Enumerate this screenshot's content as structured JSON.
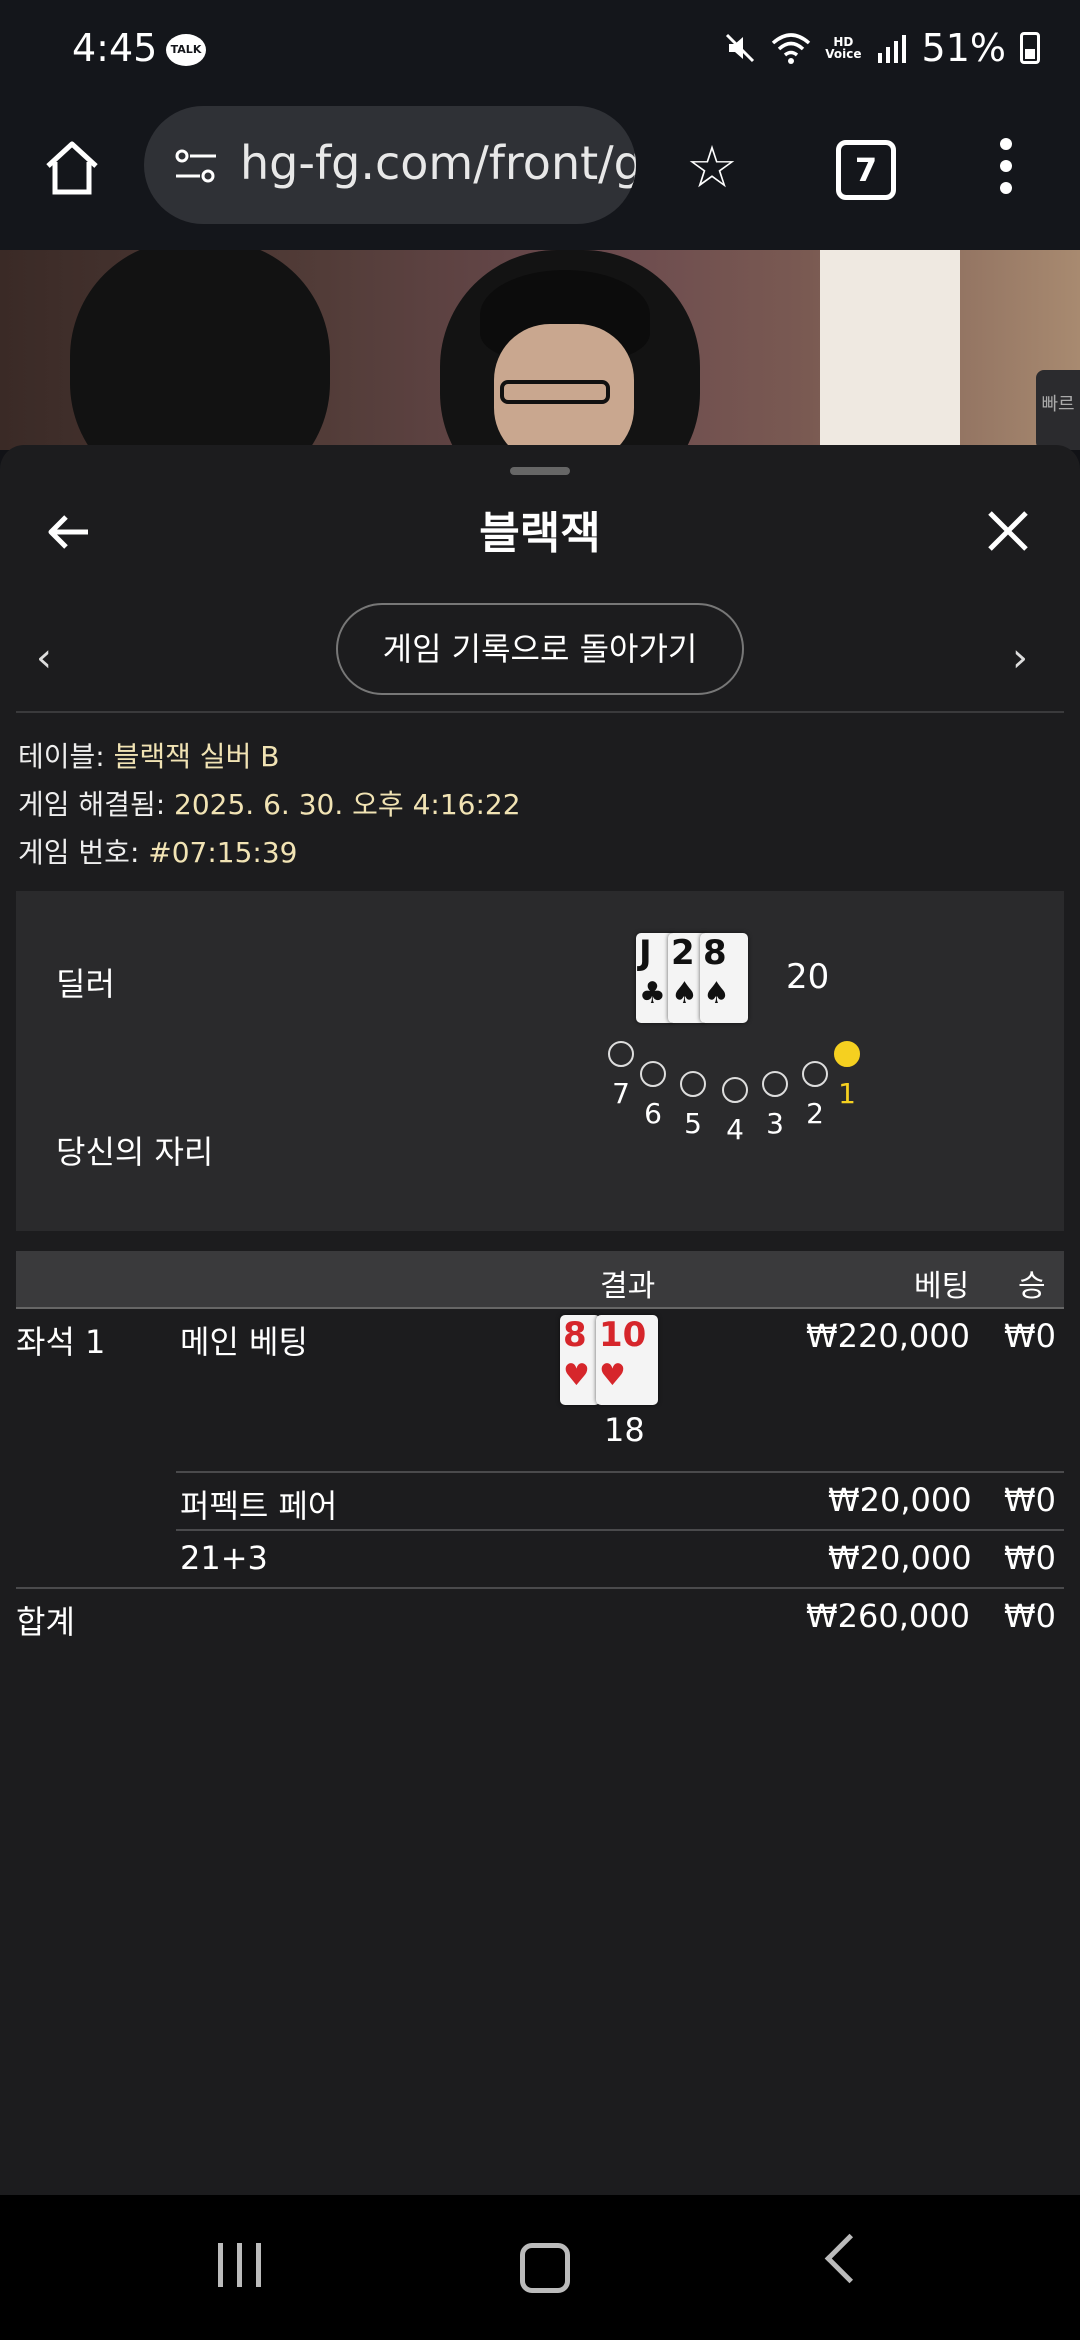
{
  "status_bar": {
    "time": "4:45",
    "talk_badge": "TALK",
    "hd_label": "HD",
    "voice_label": "Voice",
    "battery": "51%"
  },
  "browser": {
    "url": "hg-fg.com/front/g",
    "tab_count": "7"
  },
  "video": {
    "side_tab_label": "빠르"
  },
  "panel": {
    "title": "블랙잭",
    "history_button": "게임 기록으로 돌아가기",
    "info": {
      "table_label": "테이블: ",
      "table_value": "블랙잭 실버 B",
      "resolved_label": "게임 해결됨: ",
      "resolved_value": "2025. 6. 30. 오후 4:16:22",
      "game_no_label": "게임 번호: ",
      "game_no_value": "#07:15:39"
    },
    "dealer": {
      "label": "딜러",
      "cards": [
        {
          "rank": "J",
          "suit": "♣",
          "color": "black"
        },
        {
          "rank": "2",
          "suit": "♠",
          "color": "black"
        },
        {
          "rank": "8",
          "suit": "♠",
          "color": "black"
        }
      ],
      "total": "20"
    },
    "seats": {
      "label": "당신의 자리",
      "numbers": [
        "7",
        "6",
        "5",
        "4",
        "3",
        "2",
        "1"
      ],
      "active_seat": "1"
    }
  },
  "results_table": {
    "headers": {
      "result": "결과",
      "bet": "베팅",
      "win": "승"
    },
    "seat_label": "좌석 1",
    "rows": [
      {
        "type": "메인 베팅",
        "bet": "₩220,000",
        "win": "₩0"
      },
      {
        "type": "퍼펙트 페어",
        "bet": "₩20,000",
        "win": "₩0"
      },
      {
        "type": "21+3",
        "bet": "₩20,000",
        "win": "₩0"
      }
    ],
    "player_cards": [
      {
        "rank": "8",
        "suit": "♥",
        "color": "red"
      },
      {
        "rank": "10",
        "suit": "♥",
        "color": "red"
      }
    ],
    "player_total": "18",
    "total": {
      "label": "합계",
      "bet": "₩260,000",
      "win": "₩0"
    }
  },
  "colors": {
    "accent_yellow": "#f5d020",
    "info_value": "#f1e3b4",
    "card_red": "#d6262b"
  }
}
